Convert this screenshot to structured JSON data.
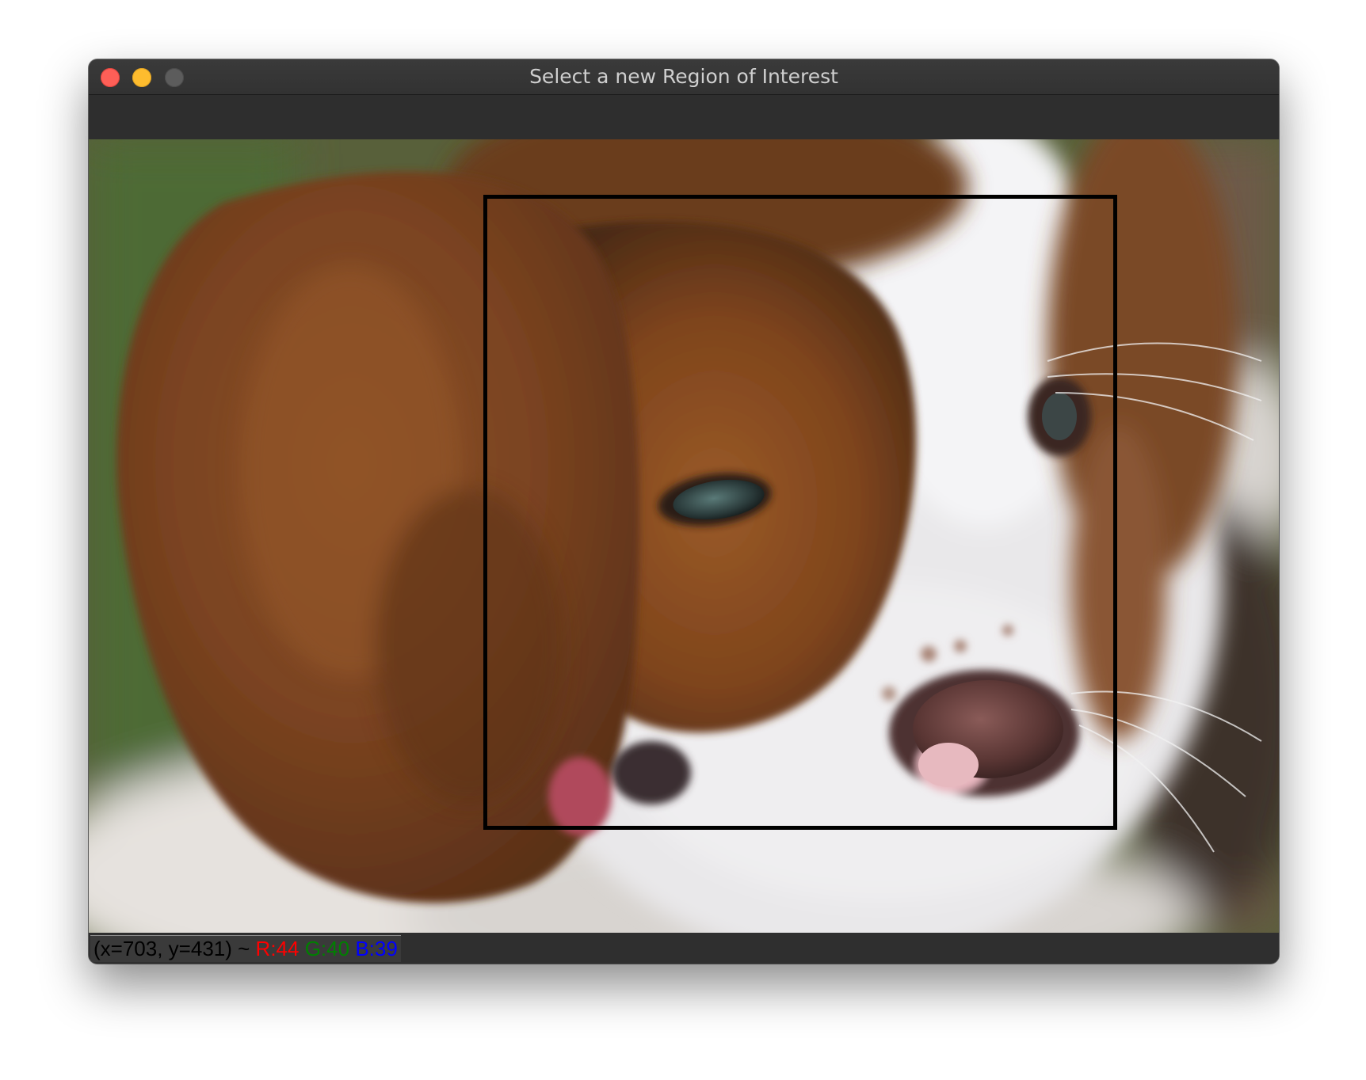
{
  "window": {
    "title": "Select a new Region of Interest"
  },
  "icons": {
    "close": "close-icon",
    "minimize": "minimize-icon",
    "zoom": "zoom-icon"
  },
  "image": {
    "subject": "beagle puppy face close-up",
    "roi_selected": true
  },
  "status": {
    "coords": "(x=703, y=431) ~",
    "r": "R:44",
    "g": "G:40",
    "b": "B:39",
    "colors": {
      "r": "#ff0000",
      "g": "#008000",
      "b": "#0000ff"
    }
  }
}
